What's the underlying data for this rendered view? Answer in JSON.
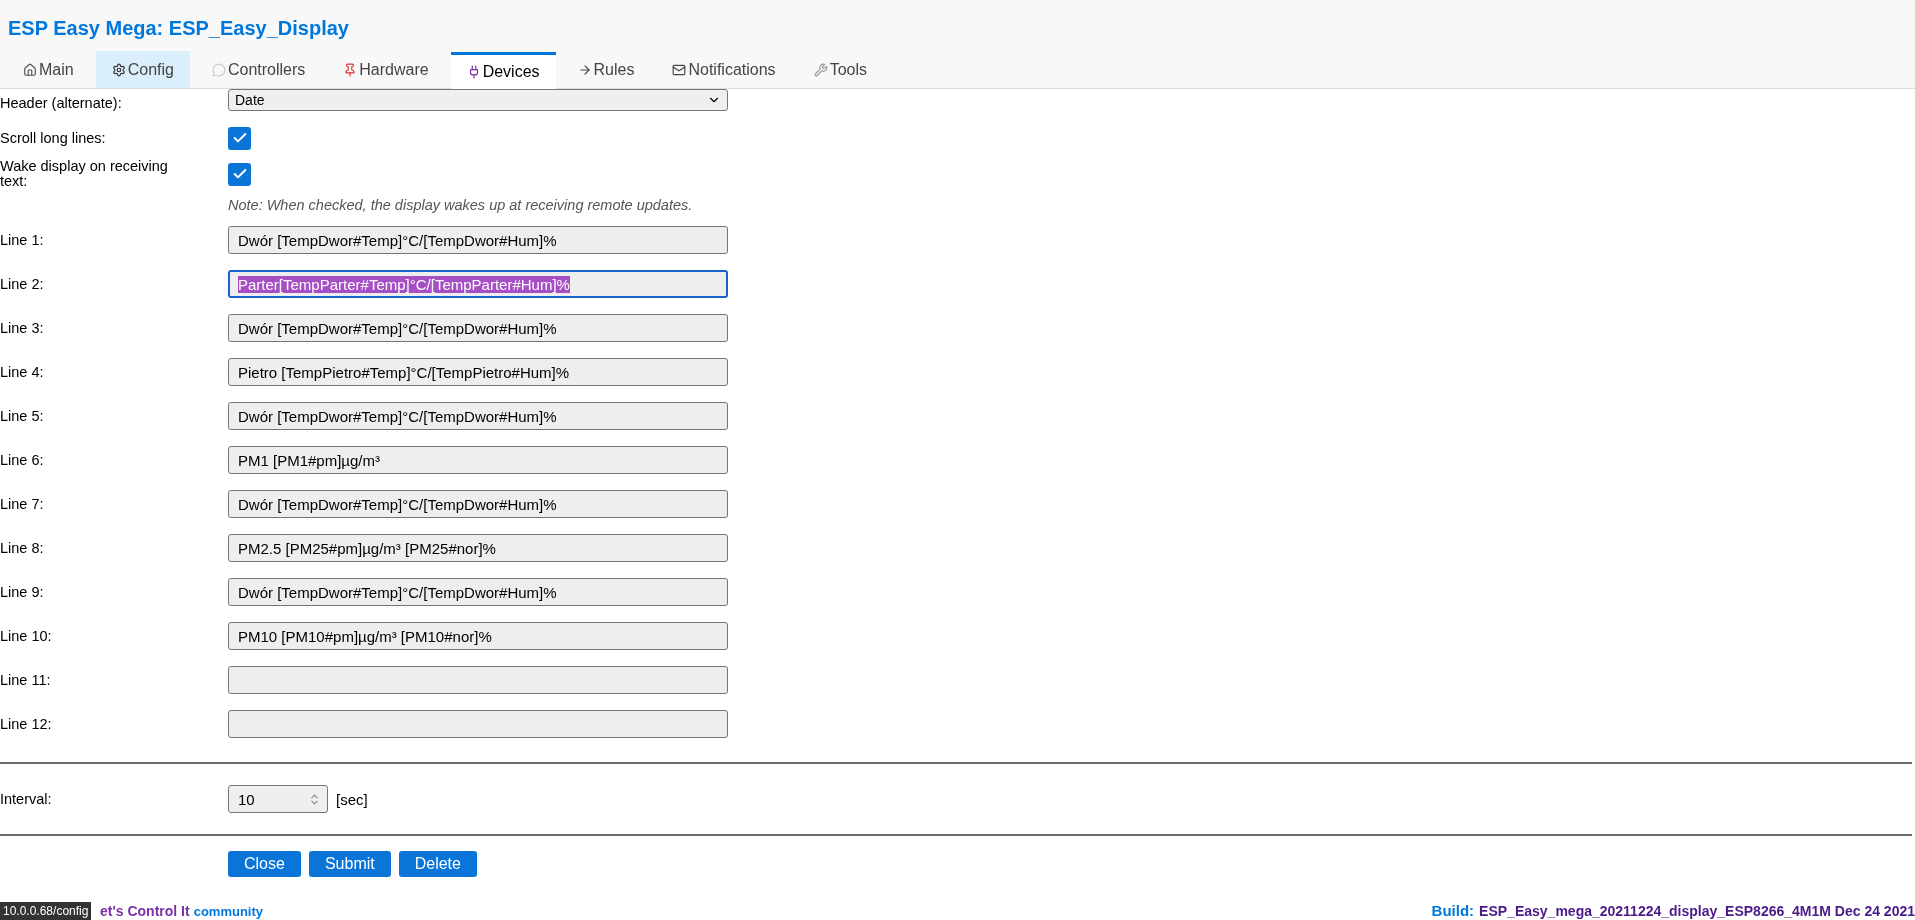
{
  "title": "ESP Easy Mega: ESP_Easy_Display",
  "tabs": [
    {
      "label": "Main",
      "kind": "home",
      "selected": false,
      "hovered": false
    },
    {
      "label": "Config",
      "kind": "config",
      "selected": false,
      "hovered": true
    },
    {
      "label": "Controllers",
      "kind": "controllers",
      "selected": false,
      "hovered": false
    },
    {
      "label": "Hardware",
      "kind": "hardware",
      "selected": false,
      "hovered": false
    },
    {
      "label": "Devices",
      "kind": "devices",
      "selected": true,
      "hovered": false
    },
    {
      "label": "Rules",
      "kind": "rules",
      "selected": false,
      "hovered": false
    },
    {
      "label": "Notifications",
      "kind": "notifications",
      "selected": false,
      "hovered": false
    },
    {
      "label": "Tools",
      "kind": "tools",
      "selected": false,
      "hovered": false
    }
  ],
  "header_alternate": {
    "label": "Header (alternate):",
    "value": "Date"
  },
  "options": [
    {
      "label": "Scroll long lines:",
      "checked": true
    },
    {
      "label": "Wake display on receiving text:",
      "checked": true
    }
  ],
  "note": "Note: When checked, the display wakes up at receiving remote updates.",
  "lines": [
    {
      "label": "Line 1:",
      "value": "Dwór [TempDwor#Temp]°C/[TempDwor#Hum]%",
      "focused": false
    },
    {
      "label": "Line 2:",
      "value": "Parter[TempParter#Temp]°C/[TempParter#Hum]%",
      "focused": true
    },
    {
      "label": "Line 3:",
      "value": "Dwór [TempDwor#Temp]°C/[TempDwor#Hum]%",
      "focused": false
    },
    {
      "label": "Line 4:",
      "value": "Pietro [TempPietro#Temp]°C/[TempPietro#Hum]%",
      "focused": false
    },
    {
      "label": "Line 5:",
      "value": "Dwór [TempDwor#Temp]°C/[TempDwor#Hum]%",
      "focused": false
    },
    {
      "label": "Line 6:",
      "value": "PM1 [PM1#pm]µg/m³",
      "focused": false
    },
    {
      "label": "Line 7:",
      "value": "Dwór [TempDwor#Temp]°C/[TempDwor#Hum]%",
      "focused": false
    },
    {
      "label": "Line 8:",
      "value": "PM2.5 [PM25#pm]µg/m³ [PM25#nor]%",
      "focused": false
    },
    {
      "label": "Line 9:",
      "value": "Dwór [TempDwor#Temp]°C/[TempDwor#Hum]%",
      "focused": false
    },
    {
      "label": "Line 10:",
      "value": "PM10 [PM10#pm]µg/m³ [PM10#nor]%",
      "focused": false
    },
    {
      "label": "Line 11:",
      "focused": false
    },
    {
      "label": "Line 12:",
      "focused": false
    }
  ],
  "interval": {
    "label": "Interval:",
    "value": "10",
    "unit": "[sec]"
  },
  "buttons": [
    "Close",
    "Submit",
    "Delete"
  ],
  "footer": {
    "brand": "et's Control It",
    "community": "community",
    "build_label": "Build:",
    "build": "ESP_Easy_mega_20211224_display_ESP8266_4M1M Dec 24 2021"
  },
  "status_tooltip": "10.0.0.68/config"
}
